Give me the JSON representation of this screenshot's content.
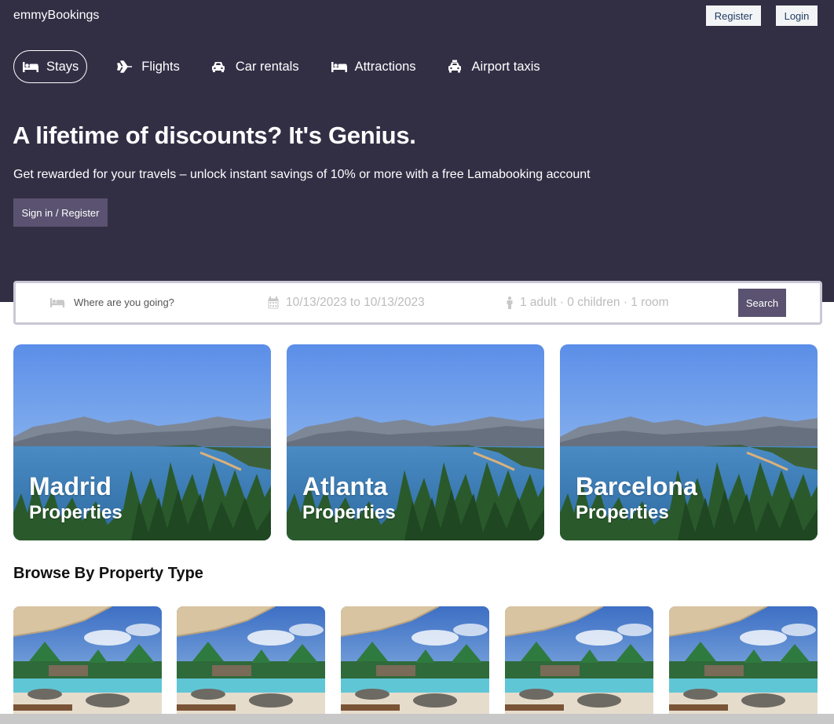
{
  "app": {
    "logo": "emmyBookings"
  },
  "auth": {
    "register_label": "Register",
    "login_label": "Login"
  },
  "nav": {
    "items": [
      {
        "label": "Stays",
        "icon": "bed-icon",
        "active": true
      },
      {
        "label": "Flights",
        "icon": "plane-icon",
        "active": false
      },
      {
        "label": "Car rentals",
        "icon": "car-icon",
        "active": false
      },
      {
        "label": "Attractions",
        "icon": "bed-icon",
        "active": false
      },
      {
        "label": "Airport taxis",
        "icon": "taxi-icon",
        "active": false
      }
    ]
  },
  "hero": {
    "title": "A lifetime of discounts? It's Genius.",
    "subtitle": "Get rewarded for your travels – unlock instant savings of 10% or more with a free Lamabooking account",
    "button_label": "Sign in / Register"
  },
  "search": {
    "destination_placeholder": "Where are you going?",
    "dates": "10/13/2023 to 10/13/2023",
    "guests": "1 adult · 0 children · 1 room",
    "button_label": "Search"
  },
  "featured": [
    {
      "city": "Madrid",
      "subtitle": "Properties"
    },
    {
      "city": "Atlanta",
      "subtitle": "Properties"
    },
    {
      "city": "Barcelona",
      "subtitle": "Properties"
    }
  ],
  "property_types": {
    "title": "Browse By Property Type",
    "count": 5
  },
  "colors": {
    "header_bg": "#322f45",
    "accent": "#5a5270",
    "search_border": "#c9c8d4"
  }
}
